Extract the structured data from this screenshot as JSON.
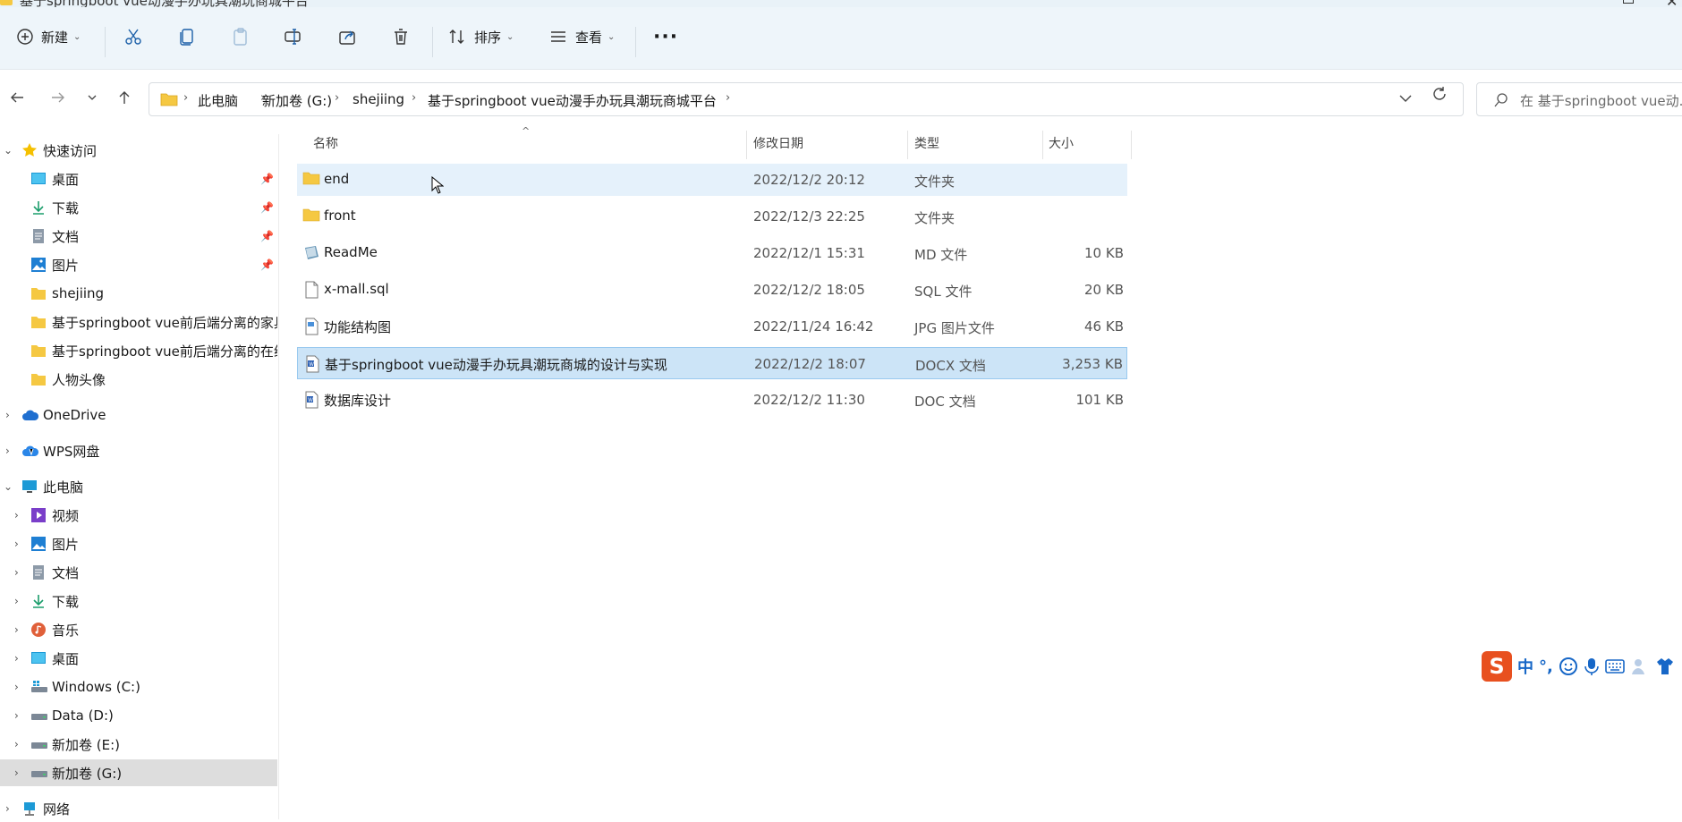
{
  "window": {
    "title": "基于springboot vue动漫手办玩具潮玩商城平台"
  },
  "toolbar": {
    "new_label": "新建",
    "sort_label": "排序",
    "view_label": "查看",
    "more_label": "···"
  },
  "address": {
    "crumbs": [
      "此电脑",
      "新加卷 (G:)",
      "shejiing",
      "基于springboot vue动漫手办玩具潮玩商城平台"
    ],
    "search_placeholder": "在 基于springboot vue动..."
  },
  "sidebar": {
    "quick_access": "快速访问",
    "quick_items": [
      {
        "label": "桌面",
        "icon": "desktop-icon"
      },
      {
        "label": "下载",
        "icon": "download-icon"
      },
      {
        "label": "文档",
        "icon": "document-icon"
      },
      {
        "label": "图片",
        "icon": "picture-icon"
      },
      {
        "label": "shejiing",
        "icon": "folder-icon"
      },
      {
        "label": "基于springboot vue前后端分离的家具",
        "icon": "folder-icon"
      },
      {
        "label": "基于springboot vue前后端分离的在线",
        "icon": "folder-icon"
      },
      {
        "label": "人物头像",
        "icon": "folder-icon"
      }
    ],
    "onedrive": "OneDrive",
    "wps": "WPS网盘",
    "this_pc": "此电脑",
    "pc_items": [
      {
        "label": "视频"
      },
      {
        "label": "图片"
      },
      {
        "label": "文档"
      },
      {
        "label": "下载"
      },
      {
        "label": "音乐"
      },
      {
        "label": "桌面"
      },
      {
        "label": "Windows (C:)"
      },
      {
        "label": "Data (D:)"
      },
      {
        "label": "新加卷 (E:)"
      },
      {
        "label": "新加卷 (G:)"
      }
    ],
    "network": "网络"
  },
  "columns": {
    "name": "名称",
    "date": "修改日期",
    "type": "类型",
    "size": "大小"
  },
  "files": [
    {
      "name": "end",
      "date": "2022/12/2 20:12",
      "type": "文件夹",
      "size": "",
      "icon": "folder-icon"
    },
    {
      "name": "front",
      "date": "2022/12/3 22:25",
      "type": "文件夹",
      "size": "",
      "icon": "folder-icon"
    },
    {
      "name": "ReadMe",
      "date": "2022/12/1 15:31",
      "type": "MD 文件",
      "size": "10 KB",
      "icon": "markdown-file-icon"
    },
    {
      "name": "x-mall.sql",
      "date": "2022/12/2 18:05",
      "type": "SQL 文件",
      "size": "20 KB",
      "icon": "blank-file-icon"
    },
    {
      "name": "功能结构图",
      "date": "2022/11/24 16:42",
      "type": "JPG 图片文件",
      "size": "46 KB",
      "icon": "image-file-icon"
    },
    {
      "name": "基于springboot vue动漫手办玩具潮玩商城的设计与实现",
      "date": "2022/12/2 18:07",
      "type": "DOCX 文档",
      "size": "3,253 KB",
      "icon": "word-file-icon"
    },
    {
      "name": "数据库设计",
      "date": "2022/12/2 11:30",
      "type": "DOC 文档",
      "size": "101 KB",
      "icon": "word-file-icon"
    }
  ],
  "ime": {
    "logo": "S",
    "mode": "中",
    "punct": "°,"
  }
}
